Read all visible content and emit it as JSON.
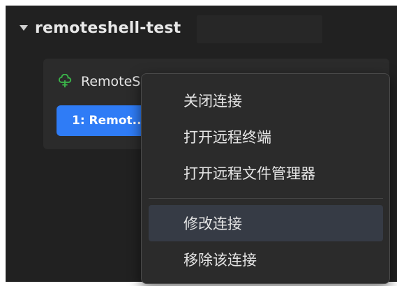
{
  "tree": {
    "title": "remoteshell-test"
  },
  "connection": {
    "name": "RemoteShell-test",
    "status_color": "#3bb54a",
    "session_tab_label": "1: Remot..."
  },
  "icons": {
    "caret": "caret-down-icon",
    "connection": "cloud-tree-icon",
    "toolbar": [
      "red-status-icon",
      "terminal-icon",
      "folder-icon"
    ]
  },
  "context_menu": {
    "items": [
      {
        "label": "关闭连接"
      },
      {
        "label": "打开远程终端"
      },
      {
        "label": "打开远程文件管理器"
      },
      {
        "label": "修改连接",
        "highlighted": true
      },
      {
        "label": "移除该连接"
      }
    ]
  },
  "colors": {
    "panel_bg": "#212121",
    "card_bg": "#2b2b2b",
    "accent_blue": "#2f7cf6",
    "menu_hover": "#363b45"
  }
}
